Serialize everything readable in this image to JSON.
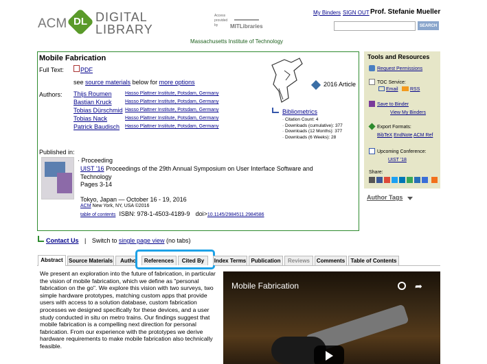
{
  "header": {
    "logo_acm": "ACM",
    "logo_dl": "DL",
    "logo_line1": "DIGITAL",
    "logo_line2": "LIBRARY",
    "access_text": "Access provided by",
    "mit_logo": "MITLibraries",
    "institution": "Massachusetts Institute of Technology",
    "my_binders": "My Binders",
    "sign_out": "SIGN OUT",
    "user_name": "Prof. Stefanie Mueller",
    "search_placeholder": "",
    "search_button": "SEARCH"
  },
  "article": {
    "title": "Mobile Fabrication",
    "full_text_label": "Full Text:",
    "pdf_label": "PDF",
    "see_pre": "see",
    "source_materials_link": "source materials",
    "see_mid": "below for",
    "more_options_link": "more options",
    "authors_label": "Authors:",
    "authors": [
      {
        "name": "Thijs Roumen",
        "affil": "Hasso Plattner Institute, Potsdam, Germany"
      },
      {
        "name": "Bastian Kruck",
        "affil": "Hasso Plattner Institute, Potsdam, Germany"
      },
      {
        "name": "Tobias Dürschmid",
        "affil": "Hasso Plattner Institute, Potsdam, Germany"
      },
      {
        "name": "Tobias Nack",
        "affil": "Hasso Plattner Institute, Potsdam, Germany"
      },
      {
        "name": "Patrick Baudisch",
        "affil": "Hasso Plattner Institute, Potsdam, Germany"
      }
    ],
    "badge_text": "2016 Article",
    "bibliometrics_label": "Bibliometrics",
    "bibliometrics": [
      "· Citation Count: 4",
      "· Downloads (cumulative): 377",
      "· Downloads (12 Months): 377",
      "· Downloads (6 Weeks): 28"
    ],
    "published_in": "Published in:",
    "proceeding_label": "· Proceeding",
    "venue_link": "UIST '16",
    "venue_title": "Proceedings of the 29th Annual Symposium on User Interface Software and Technology",
    "pages": "Pages 3-14",
    "location_dates": "Tokyo, Japan — October 16 - 19, 2016",
    "publisher_link": "ACM",
    "publisher_text": "New York, NY, USA ©2016",
    "toc_link": "table of contents",
    "isbn": "ISBN: 978-1-4503-4189-9",
    "doi_label": "doi>",
    "doi_link": "10.1145/2984511.2984586"
  },
  "contact": {
    "contact_link": "Contact Us",
    "separator": "|",
    "switch_text": "Switch to",
    "single_page_link": "single page view",
    "no_tabs": "(no tabs)"
  },
  "tabs": [
    {
      "label": "Abstract"
    },
    {
      "label": "Source Materials"
    },
    {
      "label": "Authors"
    },
    {
      "label": "References"
    },
    {
      "label": "Cited By"
    },
    {
      "label": "Index Terms"
    },
    {
      "label": "Publication"
    },
    {
      "label": "Reviews"
    },
    {
      "label": "Comments"
    },
    {
      "label": "Table of Contents"
    }
  ],
  "abstract_text": "We present an exploration into the future of fabrication, in particular the vision of mobile fabrication, which we define as \"personal fabrication on the go\". We explore this vision with two surveys, two simple hardware prototypes, matching custom apps that provide users with access to a solution database, custom fabrication processes we designed specifically for these devices, and a user study conducted in situ on metro trains. Our findings suggest that mobile fabrication is a compelling next direction for personal fabrication. From our experience with the prototypes we derive hardware requirements to make mobile fabrication also technically feasible.",
  "video": {
    "title": "Mobile Fabrication"
  },
  "sidebar": {
    "title": "Tools and Resources",
    "request_permissions": "Request Permissions",
    "toc_service": "TOC Service:",
    "email": "Email",
    "rss": "RSS",
    "save_to_binder": "Save to Binder",
    "view_binders": "View My Binders",
    "export_formats": "Export Formats:",
    "bibtex": "BibTeX",
    "endnote": "EndNote",
    "acm_ref": "ACM Ref",
    "upcoming": "Upcoming Conference:",
    "uist18": "UIST '18",
    "share": "Share:",
    "author_tags": "Author Tags"
  },
  "colors": {
    "green_border": "#2d8a2d",
    "link_blue": "#00008b",
    "sidebar_bg": "#e6e6c8",
    "highlight": "#1da1e6"
  }
}
